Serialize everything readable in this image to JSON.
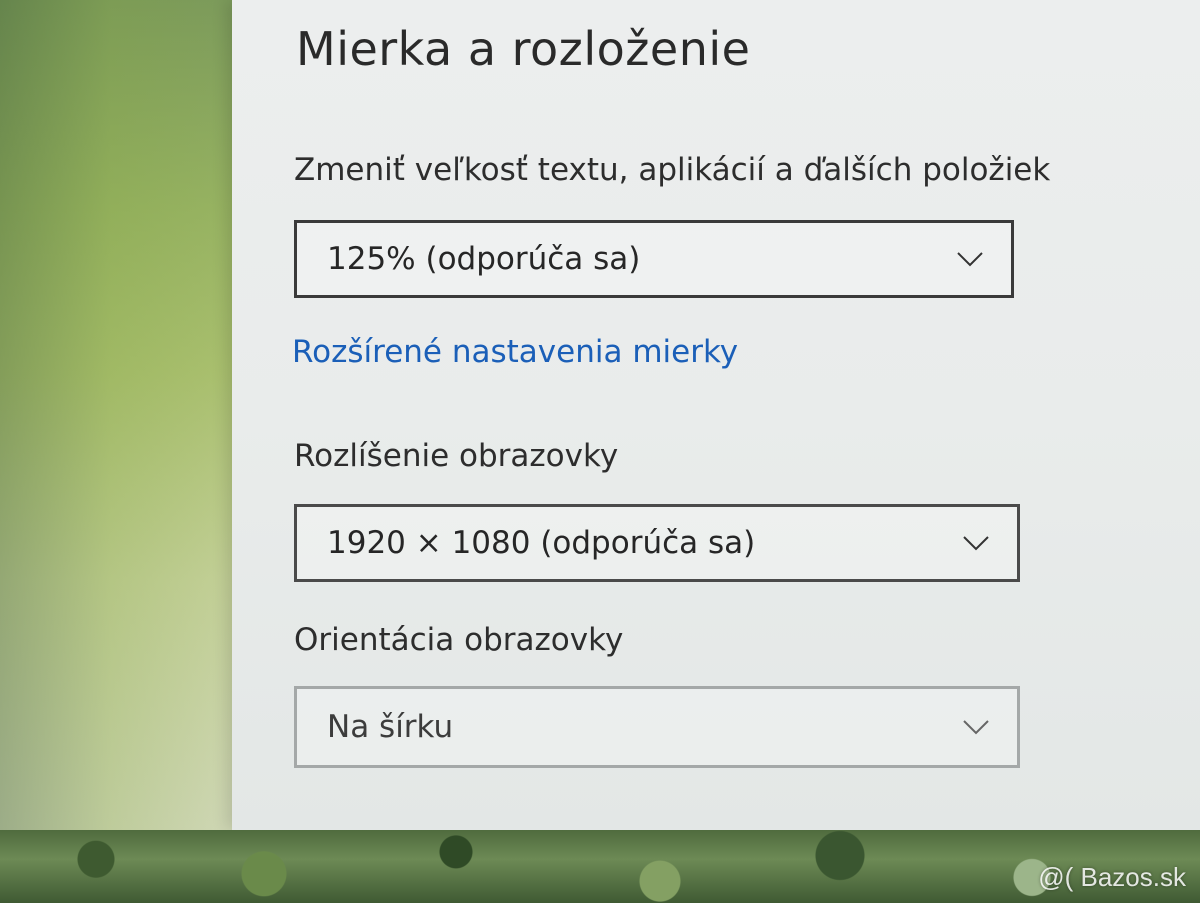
{
  "section": {
    "title": "Mierka a rozloženie"
  },
  "scale": {
    "label": "Zmeniť veľkosť textu, aplikácií a ďalších položiek",
    "value": "125% (odporúča sa)"
  },
  "advanced_link": {
    "label": "Rozšírené nastavenia mierky"
  },
  "resolution": {
    "label": "Rozlíšenie obrazovky",
    "value": "1920 × 1080 (odporúča sa)"
  },
  "orientation": {
    "label": "Orientácia obrazovky",
    "value": "Na šírku"
  },
  "watermark": {
    "text": "@( Bazos.sk"
  },
  "colors": {
    "link": "#1b5fb8",
    "text": "#2a2a2a",
    "panel_bg": "#eceeee"
  },
  "icons": {
    "dropdown_chevron": "chevron-down-icon"
  }
}
